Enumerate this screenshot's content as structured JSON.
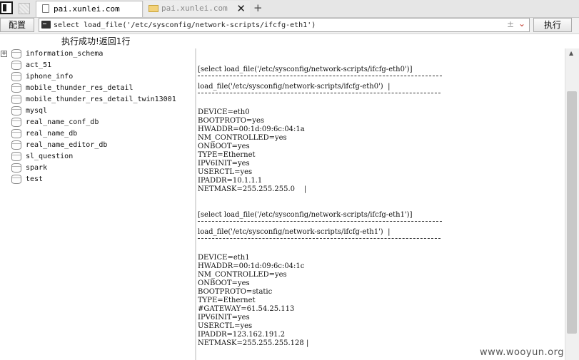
{
  "tabs": [
    {
      "label": "pai.xunlei.com",
      "active": true
    },
    {
      "label": "pai.xunlei.com",
      "active": false
    }
  ],
  "toolbar": {
    "config_label": "配置",
    "query_value": "select load_file('/etc/sysconfig/network-scripts/ifcfg-eth1')",
    "execute_label": "执行"
  },
  "status_text": "执行成功!返回1行",
  "databases": [
    "information_schema",
    "act_51",
    "iphone_info",
    "mobile_thunder_res_detail",
    "mobile_thunder_res_detail_twin13001",
    "mysql",
    "real_name_conf_db",
    "real_name_db",
    "real_name_editor_db",
    "sl_question",
    "spark",
    "test"
  ],
  "results": [
    {
      "query_header": "[select load_file('/etc/sysconfig/network-scripts/ifcfg-eth0')]",
      "column_header": "load_file('/etc/sysconfig/network-scripts/ifcfg-eth0')  |",
      "lines": [
        "DEVICE=eth0",
        "BOOTPROTO=yes",
        "HWADDR=00:1d:09:6c:04:1a",
        "NM_CONTROLLED=yes",
        "ONBOOT=yes",
        "TYPE=Ethernet",
        "IPV6INIT=yes",
        "USERCTL=yes",
        "IPADDR=10.1.1.1",
        "NETMASK=255.255.255.0    |"
      ]
    },
    {
      "query_header": "[select load_file('/etc/sysconfig/network-scripts/ifcfg-eth1')]",
      "column_header": "load_file('/etc/sysconfig/network-scripts/ifcfg-eth1')  |",
      "lines": [
        "DEVICE=eth1",
        "HWADDR=00:1d:09:6c:04:1c",
        "NM_CONTROLLED=yes",
        "ONBOOT=yes",
        "BOOTPROTO=static",
        "TYPE=Ethernet",
        "#GATEWAY=61.54.25.113",
        "IPV6INIT=yes",
        "USERCTL=yes",
        "IPADDR=123.162.191.2",
        "NETMASK=255.255.255.128 |"
      ]
    }
  ],
  "watermark": "www.wooyun.org"
}
